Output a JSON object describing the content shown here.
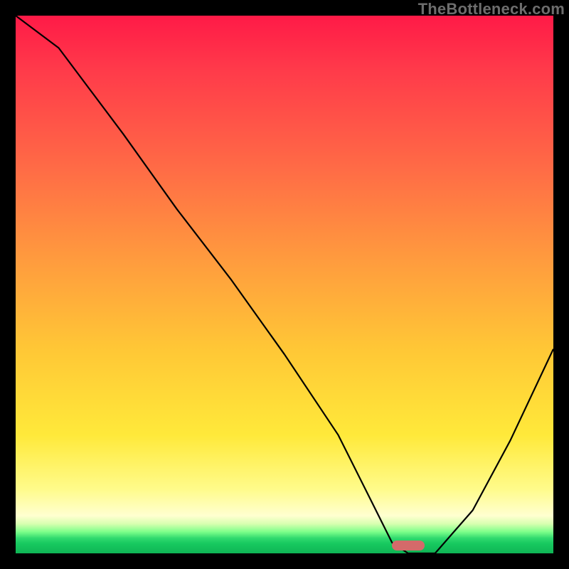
{
  "watermark": "TheBottleneck.com",
  "chart_data": {
    "type": "line",
    "title": "",
    "xlabel": "",
    "ylabel": "",
    "xlim": [
      0,
      100
    ],
    "ylim": [
      0,
      100
    ],
    "grid": false,
    "series": [
      {
        "name": "curve",
        "x": [
          0,
          8,
          20,
          30,
          40,
          50,
          60,
          66,
          70,
          73,
          78,
          85,
          92,
          100
        ],
        "y": [
          100,
          94,
          78,
          64,
          51,
          37,
          22,
          10,
          2,
          0,
          0,
          8,
          21,
          38
        ]
      }
    ],
    "marker": {
      "x_start": 70,
      "x_end": 76,
      "y": 0,
      "color": "#d46a6a"
    },
    "background_gradient": {
      "stops": [
        {
          "pos": 0.0,
          "color": "#ff1a47"
        },
        {
          "pos": 0.45,
          "color": "#ff9a3e"
        },
        {
          "pos": 0.78,
          "color": "#ffe93a"
        },
        {
          "pos": 0.93,
          "color": "#ffffd0"
        },
        {
          "pos": 0.97,
          "color": "#2fd96e"
        },
        {
          "pos": 1.0,
          "color": "#0fb555"
        }
      ]
    }
  }
}
